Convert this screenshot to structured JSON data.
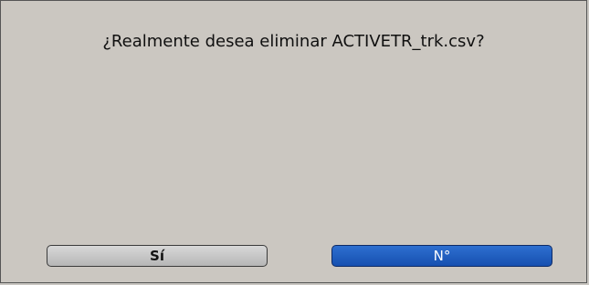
{
  "dialog": {
    "message": "¿Realmente desea eliminar ACTIVETR_trk.csv?",
    "yes_label": "Sí",
    "no_label": "N°"
  },
  "colors": {
    "background": "#cbc7c1",
    "selected_button": "#1f5fc4",
    "normal_button": "#c8c8c8"
  }
}
